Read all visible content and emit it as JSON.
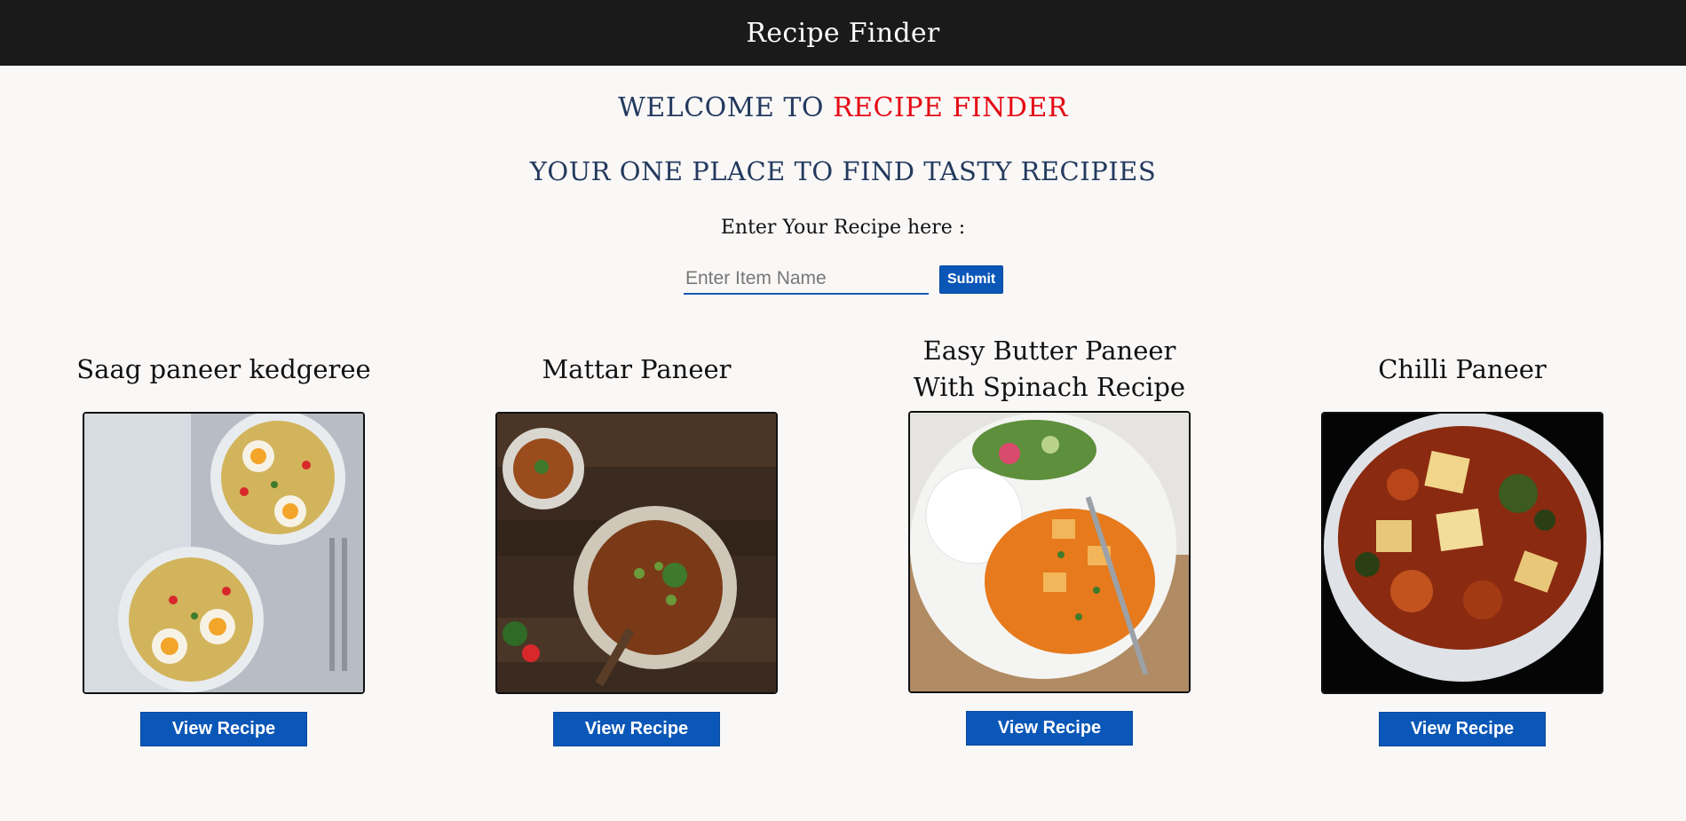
{
  "navbar": {
    "brand": "Recipe Finder"
  },
  "hero": {
    "welcome_prefix": "Welcome to ",
    "welcome_accent": "Recipe Finder",
    "tagline": "Your one place to find tasty recipies",
    "prompt_label": "Enter Your Recipe here :"
  },
  "search": {
    "placeholder": "Enter Item Name",
    "value": "",
    "submit_label": "Submit"
  },
  "recipes": [
    {
      "title": "Saag paneer kedgeree",
      "button_label": "View Recipe",
      "image_icon": "noodle-bowls-image"
    },
    {
      "title": "Mattar Paneer",
      "button_label": "View Recipe",
      "image_icon": "curry-bowl-image"
    },
    {
      "title": "Easy Butter Paneer With Spinach Recipe",
      "button_label": "View Recipe",
      "image_icon": "butter-paneer-plate-image"
    },
    {
      "title": "Chilli Paneer",
      "button_label": "View Recipe",
      "image_icon": "chilli-paneer-bowl-image"
    }
  ],
  "colors": {
    "navbar_bg": "#1a1a1a",
    "heading": "#233a5e",
    "accent": "#e50914",
    "button": "#0b57b8",
    "page_bg": "#faf8f7"
  }
}
